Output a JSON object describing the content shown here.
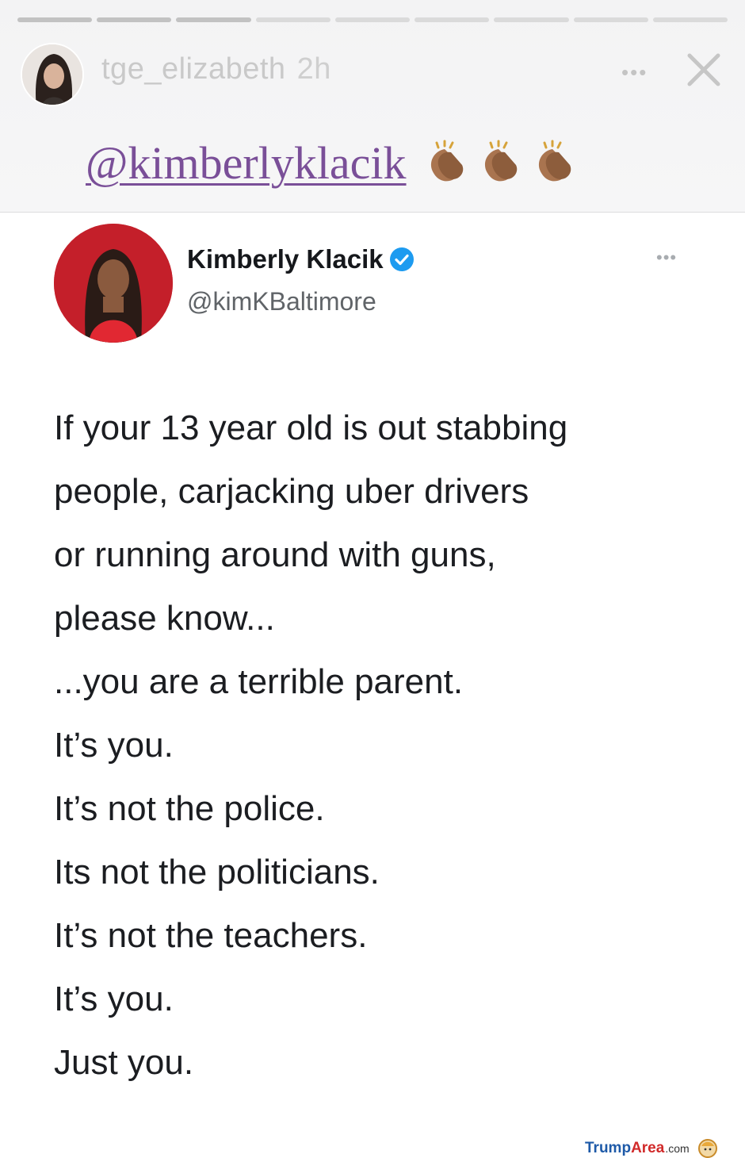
{
  "story": {
    "username": "tge_elizabeth",
    "time_ago": "2h",
    "more_label": "•••",
    "mention": "@kimberlyklacik",
    "progress_segments": 9,
    "progress_done": 3
  },
  "tweet": {
    "display_name": "Kimberly Klacik",
    "handle": "@kimKBaltimore",
    "verified": true,
    "more_label": "•••",
    "text": "If your 13 year old is out stabbing\npeople, carjacking uber drivers\nor running around with guns,\nplease know...\n...you are a terrible parent.\nIt’s you.\nIt’s not the police.\nIts not the politicians.\nIt’s not the teachers.\nIt’s you.\nJust you."
  },
  "watermark": {
    "part1": "Trump",
    "part2": "Area",
    "part3": ".com"
  },
  "colors": {
    "mention": "#7a4f98",
    "verified_badge": "#1d9bf0",
    "watermark_blue": "#1e5aa8",
    "watermark_red": "#d12a2a"
  },
  "icons": [
    "close-icon",
    "clapping-hands-icon",
    "verified-badge-icon",
    "more-icon"
  ]
}
